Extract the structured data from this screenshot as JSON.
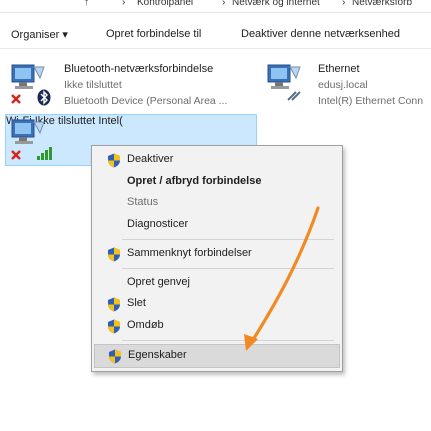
{
  "address_bar": {
    "segments": [
      "Kontrolpanel",
      "Netværk og internet",
      "Netværksforb"
    ]
  },
  "toolbar": {
    "organize": "Organiser ▾",
    "create": "Opret forbindelse til",
    "disable_device": "Deaktiver denne netværksenhed"
  },
  "connections": [
    {
      "name": "Bluetooth-netværksforbindelse",
      "status": "Ikke tilsluttet",
      "device": "Bluetooth Device (Personal Area ..."
    },
    {
      "name": "Ethernet",
      "status": "edusj.local",
      "device": "Intel(R) Ethernet Conn"
    },
    {
      "name": "Wi-Fi",
      "status": "Ikke tilsluttet",
      "device": "Intel("
    }
  ],
  "context_menu": {
    "items": [
      {
        "label": "Deaktiver"
      },
      {
        "label": "Opret / afbryd forbindelse"
      },
      {
        "label": "Status"
      },
      {
        "label": "Diagnosticer"
      },
      {
        "label": "Sammenknyt forbindelser"
      },
      {
        "label": "Opret genvej"
      },
      {
        "label": "Slet"
      },
      {
        "label": "Omdøb"
      },
      {
        "label": "Egenskaber"
      }
    ]
  },
  "colors": {
    "selection": "#cce8ff",
    "arrow": "#f28a23",
    "error": "#d4281c",
    "hover": "#dadada"
  }
}
